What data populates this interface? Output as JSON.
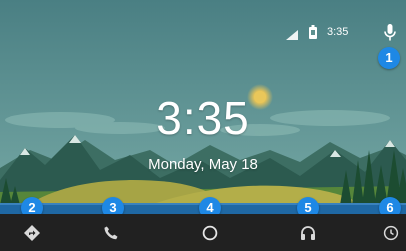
{
  "status_bar": {
    "time": "3:35",
    "icons": [
      "signal-icon",
      "battery-icon"
    ],
    "mic_icon": "mic-icon"
  },
  "main": {
    "time": "3:35",
    "date": "Monday, May 18"
  },
  "badges": [
    "1",
    "2",
    "3",
    "4",
    "5",
    "6"
  ],
  "nav": {
    "items": [
      {
        "icon": "navigation-icon"
      },
      {
        "icon": "phone-icon"
      },
      {
        "icon": "home-icon"
      },
      {
        "icon": "headphones-icon"
      },
      {
        "icon": "overview-icon"
      }
    ]
  },
  "colors": {
    "sky_top": "#4f8487",
    "sky_bottom": "#79aaa7",
    "sun": "#e7c356",
    "mountains": "#2f5e52",
    "mountains_far": "#3f7062",
    "hills": "#a9a746",
    "meadow": "#5e8c3a",
    "trees": "#1d4f32",
    "water": "#1f6aa6",
    "nav_bar": "#212121",
    "badge": "#1e88e5",
    "icon": "#e0e0e0"
  }
}
